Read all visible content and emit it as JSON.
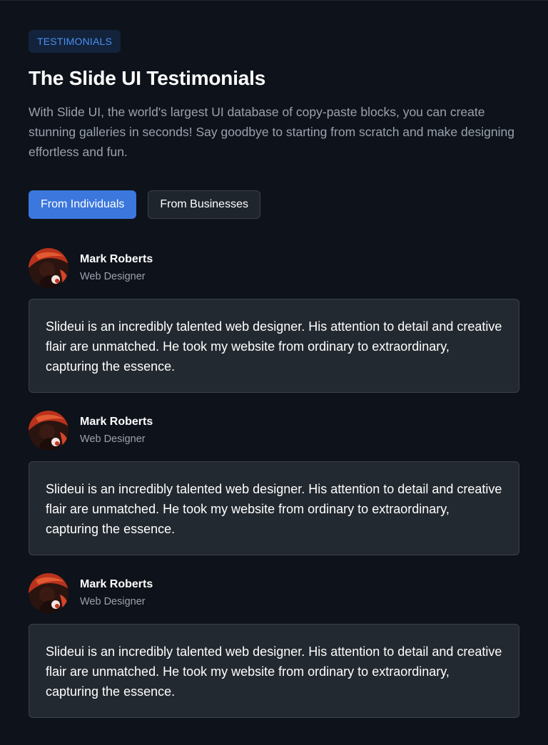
{
  "header": {
    "badge": "TESTIMONIALS",
    "title": "The Slide UI Testimonials",
    "description": "With Slide UI, the world's largest UI database of copy-paste blocks, you can create stunning galleries in seconds! Say goodbye to starting from scratch and make designing effortless and fun."
  },
  "tabs": [
    {
      "label": "From Individuals",
      "active": true
    },
    {
      "label": "From Businesses",
      "active": false
    }
  ],
  "testimonials": [
    {
      "name": "Mark Roberts",
      "role": "Web Designer",
      "quote": "Slideui is an incredibly talented web designer. His attention to detail and creative flair are unmatched. He took my website from ordinary to extraordinary, capturing the essence."
    },
    {
      "name": "Mark Roberts",
      "role": "Web Designer",
      "quote": "Slideui is an incredibly talented web designer. His attention to detail and creative flair are unmatched. He took my website from ordinary to extraordinary, capturing the essence."
    },
    {
      "name": "Mark Roberts",
      "role": "Web Designer",
      "quote": "Slideui is an incredibly talented web designer. His attention to detail and creative flair are unmatched. He took my website from ordinary to extraordinary, capturing the essence."
    }
  ],
  "colors": {
    "background": "#0e121a",
    "accent": "#3b77dc",
    "badge_text": "#4a8ff0",
    "card": "#232930"
  }
}
